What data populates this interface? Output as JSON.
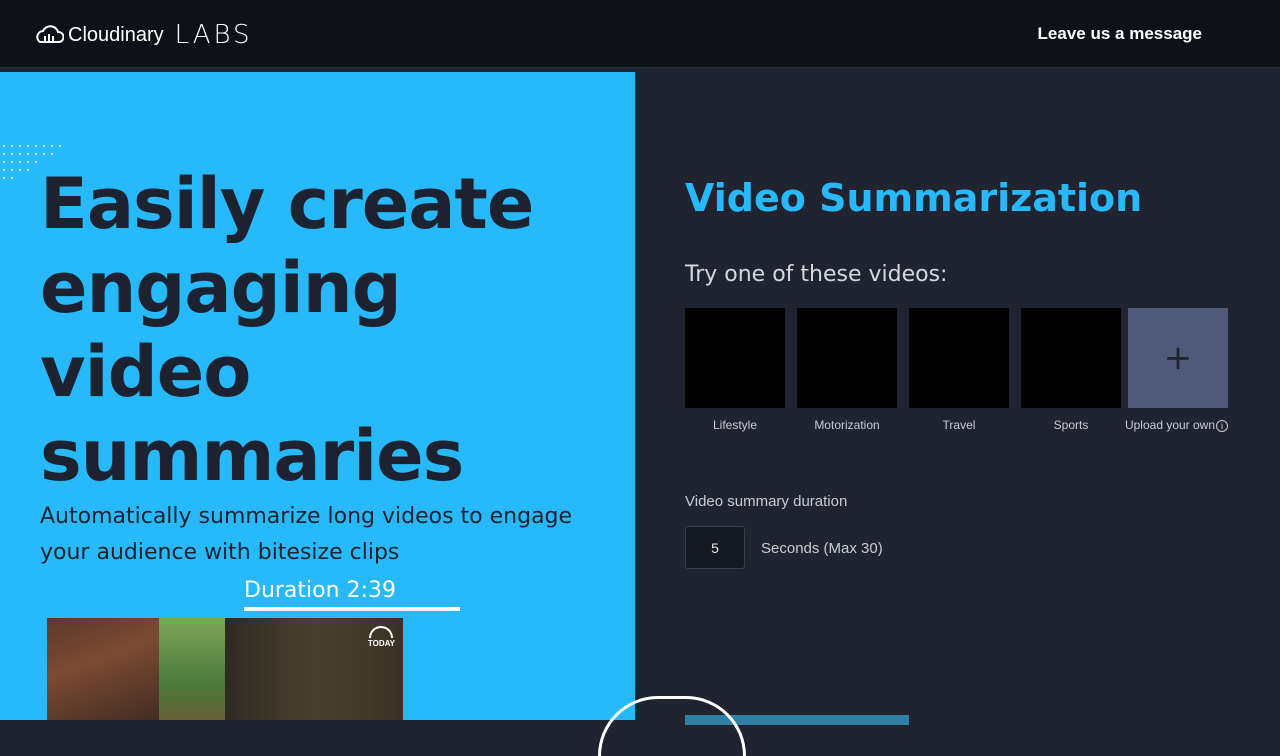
{
  "header": {
    "brand_name": "Cloudinary",
    "brand_labs": "LABS",
    "message_link": "Leave us a message"
  },
  "hero": {
    "title_lines": [
      "Easily create",
      "engaging",
      "video",
      "summaries"
    ],
    "subtitle": "Automatically summarize long videos to engage your audience with bitesize clips",
    "duration": "Duration 2:39",
    "preview_logo": "TODAY"
  },
  "panel": {
    "title": "Video Summarization",
    "try_label": "Try one of these videos:",
    "videos": [
      {
        "label": "Lifestyle"
      },
      {
        "label": "Motorization"
      },
      {
        "label": "Travel"
      },
      {
        "label": "Sports"
      }
    ],
    "upload": {
      "icon": "+",
      "label": "Upload your own",
      "info_icon": "i"
    },
    "duration_label": "Video summary duration",
    "duration_value": "5",
    "duration_unit": "Seconds (Max 30)"
  },
  "colors": {
    "accent": "#27b9fa",
    "header_bg": "#0e1118",
    "panel_bg": "#1f2430",
    "upload_bg": "#505a78"
  },
  "icons": {
    "logo": "cloud-icon",
    "add": "plus-icon",
    "info": "info-icon"
  }
}
